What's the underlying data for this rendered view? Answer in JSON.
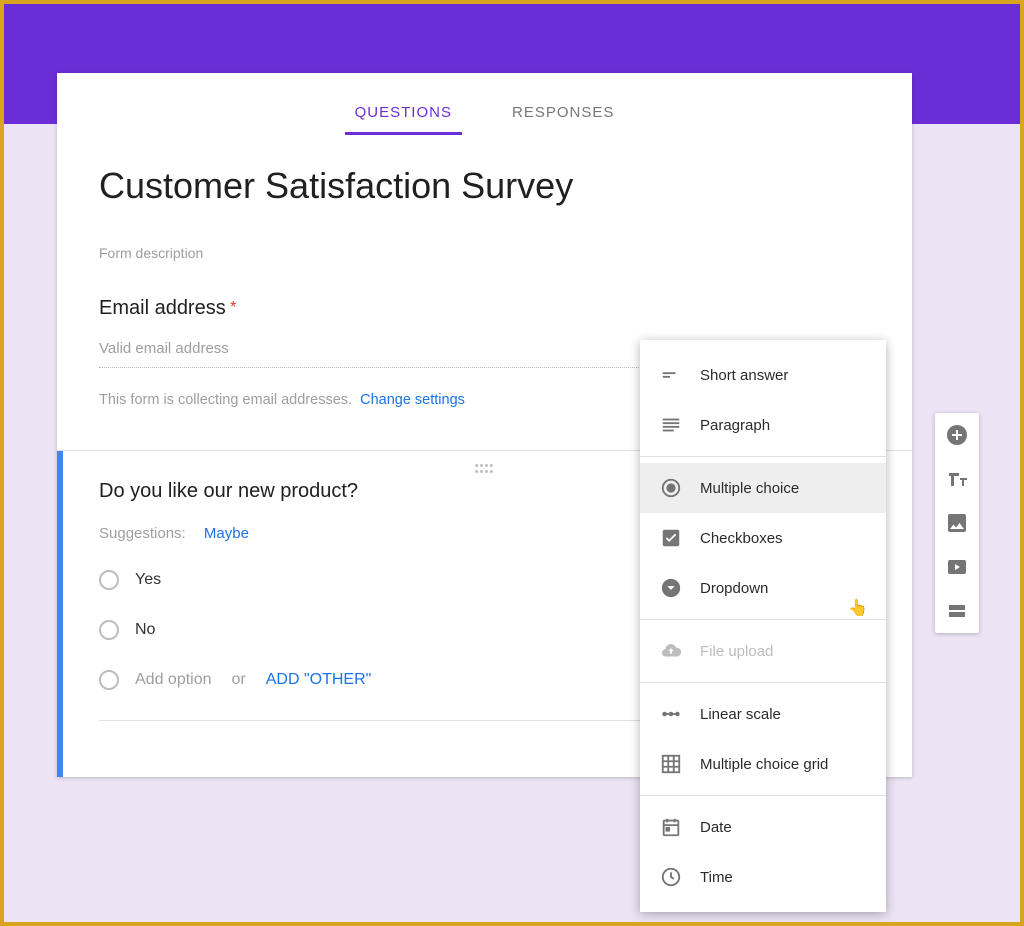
{
  "tabs": {
    "questions": "QUESTIONS",
    "responses": "RESPONSES"
  },
  "form": {
    "title": "Customer Satisfaction Survey",
    "description": "Form description",
    "email_label": "Email address",
    "email_placeholder": "Valid email address",
    "collect_note": "This form is collecting email addresses.",
    "change_settings": "Change settings"
  },
  "question": {
    "text": "Do you like our new product?",
    "suggest_label": "Suggestions:",
    "suggest_value": "Maybe",
    "options": [
      "Yes",
      "No"
    ],
    "add_option": "Add option",
    "or": "or",
    "add_other": "ADD \"OTHER\""
  },
  "menu": {
    "short_answer": "Short answer",
    "paragraph": "Paragraph",
    "multiple_choice": "Multiple choice",
    "checkboxes": "Checkboxes",
    "dropdown": "Dropdown",
    "file_upload": "File upload",
    "linear_scale": "Linear scale",
    "multiple_choice_grid": "Multiple choice grid",
    "date": "Date",
    "time": "Time"
  }
}
